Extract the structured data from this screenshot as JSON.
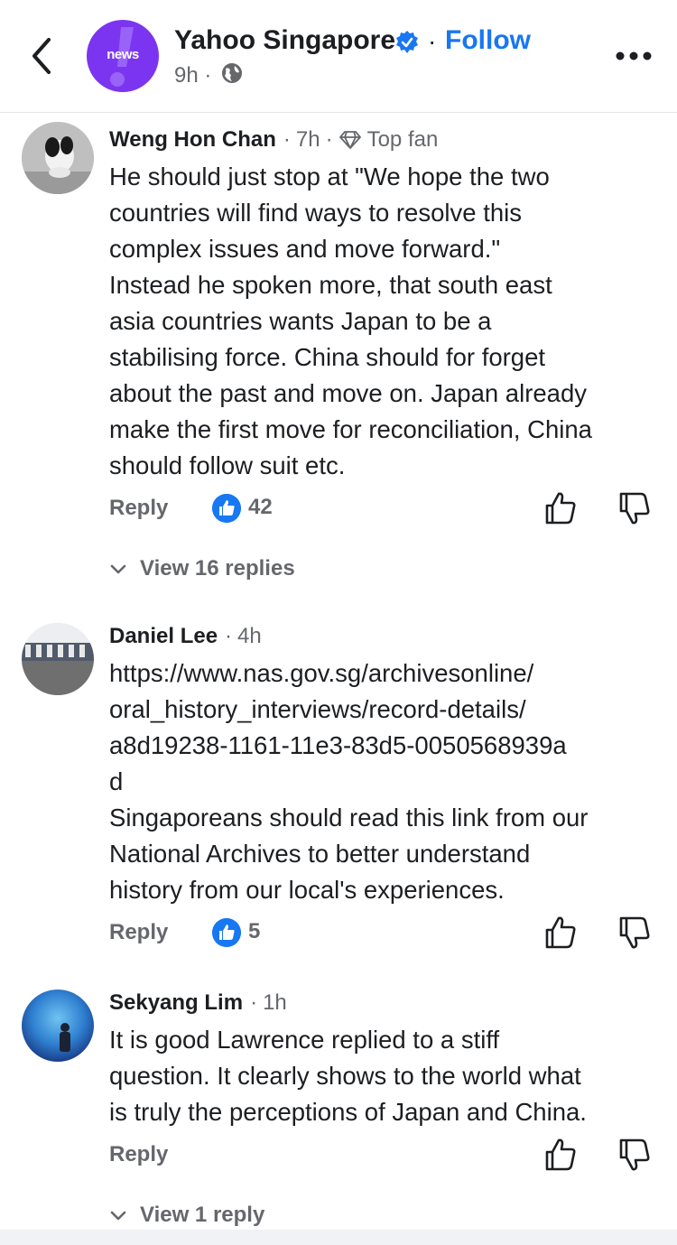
{
  "header": {
    "page_name": "Yahoo Singapore",
    "logo_text": "news",
    "separator": "·",
    "follow_label": "Follow",
    "post_time": "9h",
    "dot": "·",
    "accent_color": "#1877f2",
    "logo_color": "#7b35f0"
  },
  "comments": [
    {
      "author": "Weng Hon Chan",
      "time": "7h",
      "badge": "Top fan",
      "text": "He should just stop at \"We hope the two\ncountries will find ways to resolve this\ncomplex issues and move forward.\"\nInstead he spoken more, that south east\nasia countries wants Japan to be a\nstabilising force. China should for forget\nabout the past and move on. Japan already\nmake the first move for reconciliation, China\nshould follow suit etc.",
      "reply_label": "Reply",
      "likes": "42",
      "view_replies": "View 16 replies"
    },
    {
      "author": "Daniel Lee",
      "time": "4h",
      "text": "https://www.nas.gov.sg/archivesonline/\noral_history_interviews/record-details/\na8d19238-1161-11e3-83d5-0050568939a\nd\nSingaporeans should read this link from our\nNational Archives to better understand\nhistory from our local's experiences.",
      "reply_label": "Reply",
      "likes": "5"
    },
    {
      "author": "Sekyang Lim",
      "time": "1h",
      "text": "It is good Lawrence replied to a stiff\nquestion. It clearly shows to the world what\nis truly the perceptions of Japan and China.",
      "reply_label": "Reply",
      "view_replies": "View 1 reply"
    }
  ],
  "meta_sep": "·"
}
